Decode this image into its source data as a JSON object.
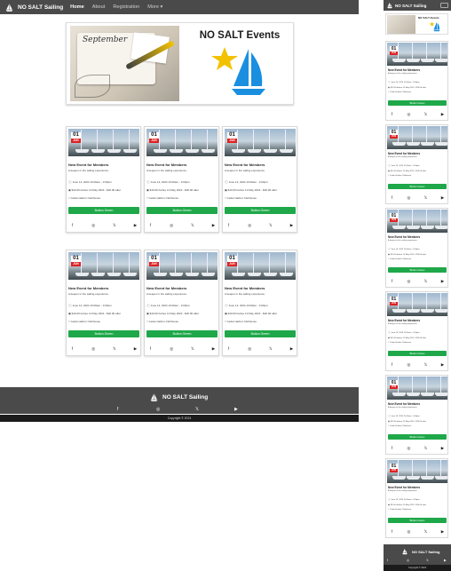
{
  "brand": {
    "name": "NO SALT Sailing"
  },
  "nav": {
    "items": [
      {
        "label": "Home",
        "active": true
      },
      {
        "label": "About"
      },
      {
        "label": "Registration"
      },
      {
        "label": "More ▾"
      }
    ]
  },
  "hero": {
    "title": "NO SALT Events",
    "photo_text": "September",
    "logo_colors": {
      "star": "#f2c200",
      "sail": "#1a8fe0"
    }
  },
  "event_card": {
    "date_day": "01",
    "date_month": "JUN",
    "title": "New Event for Members",
    "description": "A keeper in the sailing experience.",
    "when": "June 14, 2024 10:00am - 3:00pm",
    "cost": "$10.00 before 10 May 2024 - $20.00 after",
    "location": "Cedar Harbor Clubhouse",
    "button_label": "Button Green",
    "social": [
      "f",
      "◎",
      "𝕏",
      "▶"
    ]
  },
  "event_count_desktop": 6,
  "event_count_mobile": 6,
  "footer": {
    "copyright": "Copyright © 2024"
  },
  "colors": {
    "nav_bg": "#4a4a4a",
    "button_green": "#1fa84a",
    "date_red": "#dd2222",
    "copyright_bg": "#1b1b1b"
  }
}
